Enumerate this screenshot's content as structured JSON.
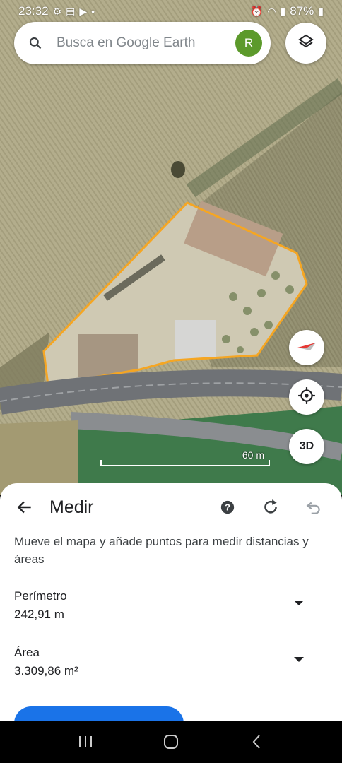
{
  "status_bar": {
    "time": "23:32",
    "battery": "87%"
  },
  "search": {
    "placeholder": "Busca en Google Earth",
    "avatar_letter": "R"
  },
  "map": {
    "scale_label": "60 m",
    "btn_3d_label": "3D",
    "polygon_color": "#f5a623"
  },
  "sheet": {
    "title": "Medir",
    "instructions": "Mueve el mapa y añade puntos para medir distancias y áreas",
    "perimeter": {
      "label": "Perímetro",
      "value": "242,91 m"
    },
    "area": {
      "label": "Área",
      "value": "3.309,86 m²"
    }
  },
  "colors": {
    "accent": "#1a73e8",
    "avatar": "#5c9a2b"
  },
  "icons": {
    "search": "search-icon",
    "layers": "layers-icon",
    "compass": "compass-icon",
    "location": "my-location-icon",
    "back": "arrow-back-icon",
    "help": "help-icon",
    "redo": "redo-icon",
    "undo": "undo-icon"
  }
}
